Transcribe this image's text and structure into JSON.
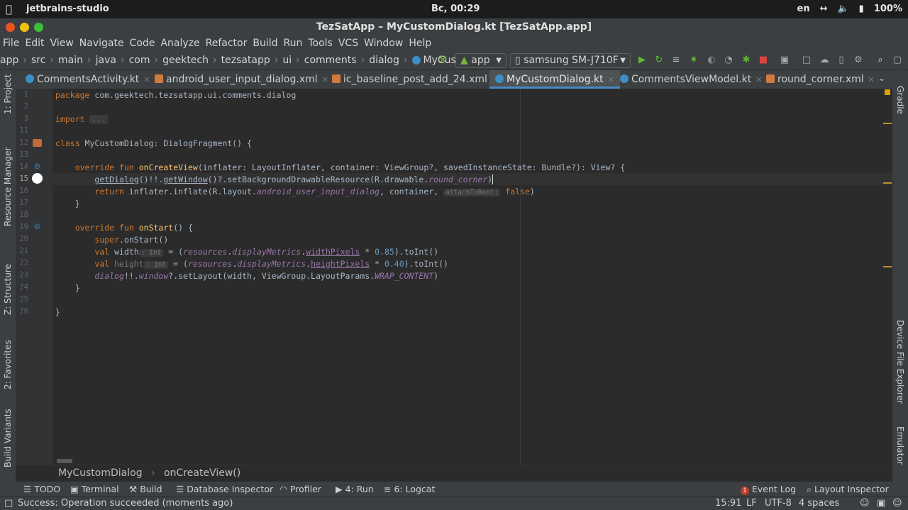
{
  "system_bar": {
    "app_name": "jetbrains-studio",
    "clock": "Вс, 00:29",
    "lang": "en",
    "battery": "100%"
  },
  "window": {
    "title": "TezSatApp – MyCustomDialog.kt [TezSatApp.app]"
  },
  "menu": [
    "File",
    "Edit",
    "View",
    "Navigate",
    "Code",
    "Analyze",
    "Refactor",
    "Build",
    "Run",
    "Tools",
    "VCS",
    "Window",
    "Help"
  ],
  "breadcrumb": [
    "app",
    "src",
    "main",
    "java",
    "com",
    "geektech",
    "tezsatapp",
    "ui",
    "comments",
    "dialog",
    "MyCustomI"
  ],
  "toolbar": {
    "run_config": "app",
    "device": "samsung SM-J710F"
  },
  "tabs": [
    {
      "label": "CommentsActivity.kt",
      "type": "kt"
    },
    {
      "label": "android_user_input_dialog.xml",
      "type": "xml"
    },
    {
      "label": "ic_baseline_post_add_24.xml",
      "type": "xml"
    },
    {
      "label": "MyCustomDialog.kt",
      "type": "kt",
      "active": true
    },
    {
      "label": "CommentsViewModel.kt",
      "type": "kt"
    },
    {
      "label": "round_corner.xml",
      "type": "xml"
    }
  ],
  "left_tools": [
    "1: Project",
    "Resource Manager",
    "Z: Structure",
    "2: Favorites",
    "Build Variants"
  ],
  "right_tools": [
    "Gradle",
    "Device File Explorer",
    "Emulator"
  ],
  "line_numbers": [
    "1",
    "2",
    "3",
    "11",
    "12",
    "13",
    "14",
    "15",
    "16",
    "17",
    "18",
    "19",
    "20",
    "21",
    "22",
    "23",
    "24",
    "25",
    "26"
  ],
  "code": {
    "l1_kw": "package",
    "l1_rest": " com.geektech.tezsatapp.ui.comments.dialog",
    "l3_kw": "import",
    "l3_fold": "...",
    "l12_kw": "class",
    "l12_rest": " MyCustomDialog: DialogFragment() {",
    "l14_kw": "override fun",
    "l14_fn": "onCreateView",
    "l14_rest": "(inflater: LayoutInflater, container: ViewGroup?, savedInstanceState: Bundle?): View? {",
    "l15_a": "getDialog",
    "l15_b": "()!!.",
    "l15_c": "getWindow",
    "l15_d": "()?.setBackgroundDrawableResource(R.drawable.",
    "l15_e": "round_corner",
    "l15_f": ")",
    "l16_kw": "return",
    "l16_a": " inflater.inflate(R.layout.",
    "l16_b": "android_user_input_dialog",
    "l16_c": ", container, ",
    "l16_hint": "attachToRoot:",
    "l16_d": " false",
    "l16_e": ")",
    "l17": "}",
    "l19_kw": "override fun",
    "l19_fn": "onStart",
    "l19_rest": "() {",
    "l20_kw": "super",
    "l20_rest": ".onStart()",
    "l21_kw": "val",
    "l21_name": " width",
    "l21_hint": ": Int",
    "l21_a": " = (",
    "l21_b": "resources",
    "l21_c": ".",
    "l21_d": "displayMetrics",
    "l21_e": ".",
    "l21_f": "widthPixels",
    "l21_g": " * ",
    "l21_num": "0.85",
    "l21_h": ").toInt()",
    "l22_kw": "val",
    "l22_name": " height",
    "l22_hint": ": Int",
    "l22_a": " = (",
    "l22_b": "resources",
    "l22_c": ".",
    "l22_d": "displayMetrics",
    "l22_e": ".",
    "l22_f": "heightPixels",
    "l22_g": " * ",
    "l22_num": "0.40",
    "l22_h": ").toInt()",
    "l23_a": "dialog",
    "l23_b": "!!.",
    "l23_c": "window",
    "l23_d": "?.setLayout(width, ViewGroup.LayoutParams.",
    "l23_e": "WRAP_CONTENT",
    "l23_f": ")",
    "l24": "}",
    "l26": "}"
  },
  "editor_breadcrumb": [
    "MyCustomDialog",
    "onCreateView()"
  ],
  "tool_windows_left": [
    "TODO",
    "Terminal",
    "Build",
    "Database Inspector",
    "Profiler",
    "4: Run",
    "6: Logcat"
  ],
  "tool_windows_right": [
    "Event Log",
    "Layout Inspector"
  ],
  "event_log_badge": "1",
  "status": {
    "message": "Success: Operation succeeded (moments ago)",
    "position": "15:91",
    "line_sep": "LF",
    "encoding": "UTF-8",
    "indent": "4 spaces"
  }
}
